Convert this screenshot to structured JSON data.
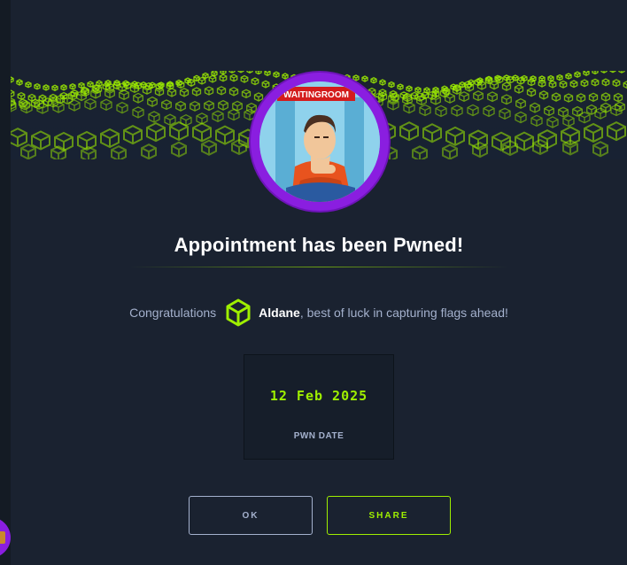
{
  "modal": {
    "avatar_badge": "WAITINGROOM",
    "title": "Appointment has been Pwned!",
    "congrats_prefix": "Congratulations",
    "username": "Aldane",
    "congrats_suffix": ", best of luck in capturing flags ahead!",
    "pwn_date": "12 Feb 2025",
    "pwn_date_label": "PWN DATE",
    "ok_label": "OK",
    "share_label": "SHARE"
  },
  "colors": {
    "accent_green": "#9fef00",
    "avatar_ring": "#8a1ee0",
    "panel_bg": "#1a2230",
    "muted_text": "#a4b1cd"
  },
  "icons": {
    "user_rank": "hexagon-cube-icon",
    "banner": "green-cube-wave"
  }
}
